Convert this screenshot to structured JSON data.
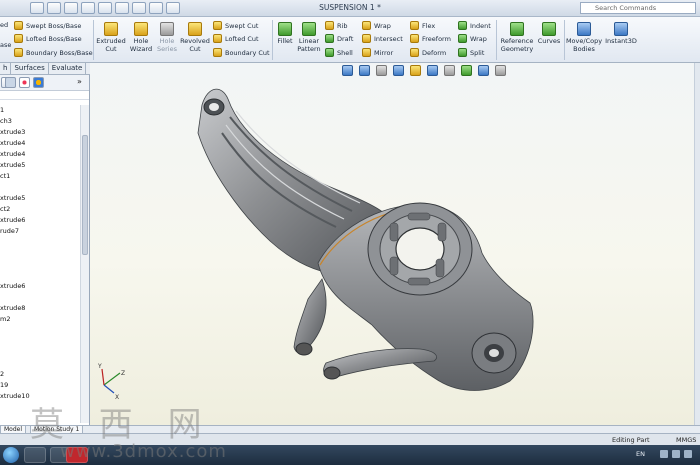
{
  "window": {
    "title": "SUSPENSION 1 *",
    "search_placeholder": "Search Commands"
  },
  "commands": {
    "extrude_partial": "ed",
    "base_partial": "ase",
    "swept_boss": "Swept Boss/Base",
    "lofted_boss": "Lofted Boss/Base",
    "boundary_boss": "Boundary Boss/Base",
    "extruded_cut": [
      "Extruded",
      "Cut"
    ],
    "hole_wizard": [
      "Hole",
      "Wizard"
    ],
    "hole_series": [
      "Hole",
      "Series"
    ],
    "revolved_cut": [
      "Revolved",
      "Cut"
    ],
    "swept_cut": "Swept Cut",
    "lofted_cut": "Lofted Cut",
    "boundary_cut": "Boundary Cut",
    "fillet": "Fillet",
    "linear_pattern": [
      "Linear",
      "Pattern"
    ],
    "rib": "Rib",
    "draft": "Draft",
    "shell": "Shell",
    "wrap": "Wrap",
    "intersect": "Intersect",
    "mirror": "Mirror",
    "flex": "Flex",
    "freeform": "Freeform",
    "deform": "Deform",
    "indent": "Indent",
    "wrap2": "Wrap",
    "split": "Split",
    "reference_geometry": [
      "Reference",
      "Geometry"
    ],
    "curves": "Curves",
    "move_copy_bodies": [
      "Move/Copy",
      "Bodies"
    ],
    "instant3d": "Instant3D"
  },
  "tabs": [
    "h",
    "Surfaces",
    "Evaluate"
  ],
  "feature_tree": [
    "1",
    "ch3",
    "xtrude3",
    "xtrude4",
    "xtrude4",
    "xtrude5",
    "ct1",
    "",
    "xtrude5",
    "ct2",
    "xtrude6",
    "rude7",
    "",
    "",
    "",
    "",
    "xtrude6",
    "",
    "xtrude8",
    "m2",
    "",
    "",
    "",
    "",
    "2",
    "19",
    "xtrude10"
  ],
  "model_tabs": {
    "model": "Model",
    "motion_study": "Motion Study 1"
  },
  "status": {
    "editing": "Editing Part",
    "units": "MMGS"
  },
  "taskbar": {
    "language": "EN"
  },
  "watermark": {
    "chinese": "莫 西 网",
    "url": "www.3dmox.com"
  },
  "colors": {
    "accent": "#3c78c4",
    "viewport_bg": "#f7f7ee",
    "part": "#8d8f92",
    "edge_highlight": "#c8842a"
  }
}
